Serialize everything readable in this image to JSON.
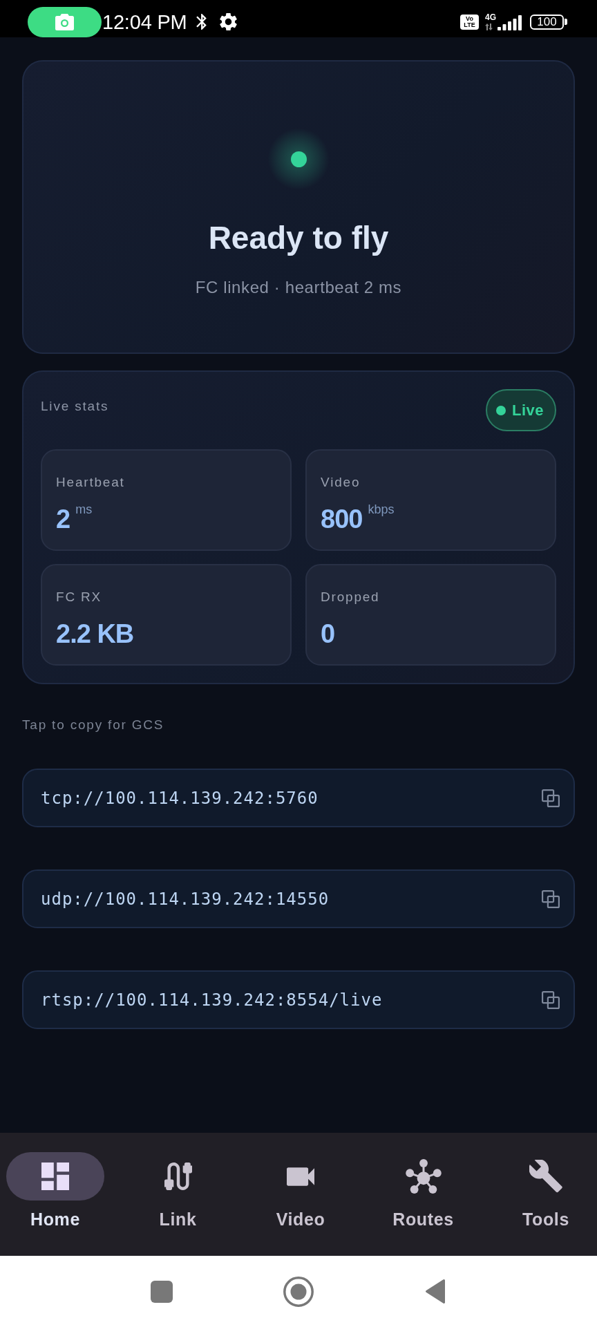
{
  "status_bar": {
    "time": "12:04 PM",
    "volte": "Vo LTE",
    "network": "4G",
    "battery": "100"
  },
  "hero": {
    "linked": true,
    "title": "Ready to fly",
    "subtitle": "FC linked · heartbeat 2 ms"
  },
  "live_stats": {
    "title": "Live stats",
    "badge": {
      "label": "Live",
      "active": true
    },
    "tiles": [
      {
        "label": "Heartbeat",
        "value": "2",
        "unit": "ms"
      },
      {
        "label": "Video",
        "value": "800",
        "unit": "kbps"
      },
      {
        "label": "FC RX",
        "value": "2.2 KB"
      },
      {
        "label": "Dropped",
        "value": "0"
      }
    ]
  },
  "endpoints": {
    "hint": "Tap to copy for GCS",
    "items": [
      {
        "url": "tcp://100.114.139.242:5760"
      },
      {
        "url": "udp://100.114.139.242:14550"
      },
      {
        "url": "rtsp://100.114.139.242:8554/live"
      }
    ]
  },
  "nav": {
    "items": [
      {
        "label": "Home",
        "selected": true
      },
      {
        "label": "Link",
        "selected": false
      },
      {
        "label": "Video",
        "selected": false
      },
      {
        "label": "Routes",
        "selected": false
      },
      {
        "label": "Tools",
        "selected": false
      }
    ]
  }
}
